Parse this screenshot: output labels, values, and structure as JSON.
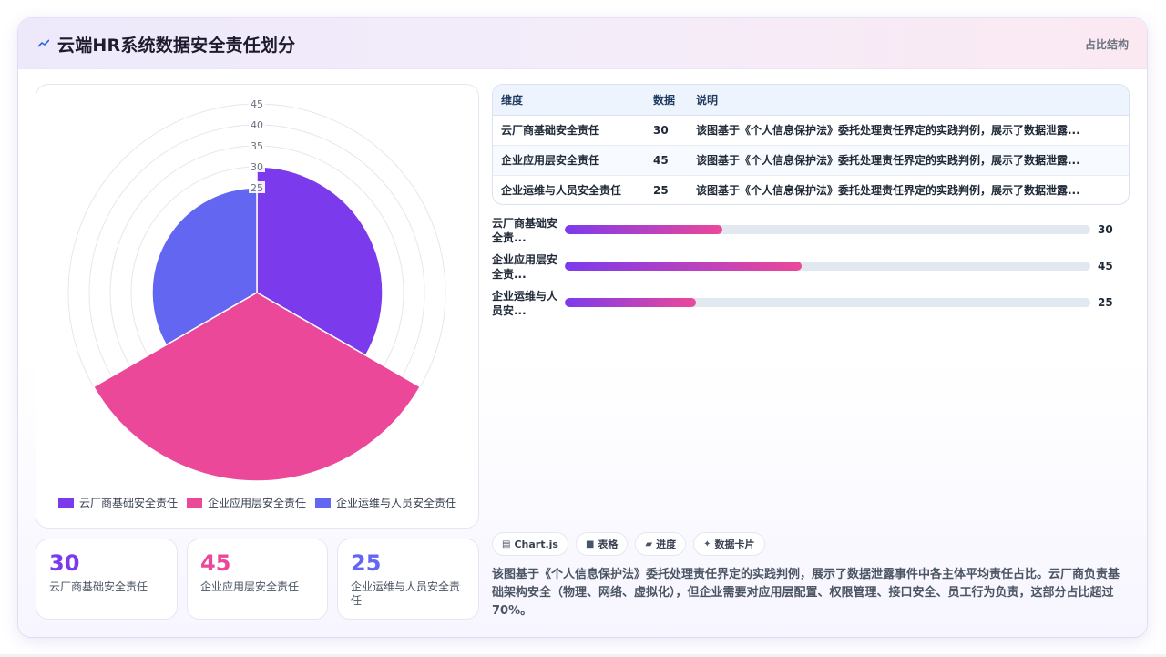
{
  "header": {
    "title": "云端HR系统数据安全责任划分",
    "tag": "占比结构",
    "icon": "trend-line-icon"
  },
  "colors": {
    "series": [
      "#7c3aed",
      "#ec4899",
      "#6366f1"
    ],
    "gradient_start": "#7c3aed",
    "gradient_end": "#ec4899"
  },
  "chart_data": {
    "type": "polar-area",
    "categories": [
      "云厂商基础安全责任",
      "企业应用层安全责任",
      "企业运维与人员安全责任"
    ],
    "values": [
      30,
      45,
      25
    ],
    "radial_ticks": [
      "25",
      "30",
      "35",
      "40",
      "45"
    ],
    "r_max": 45,
    "legend_position": "bottom",
    "grid": true
  },
  "stats": [
    {
      "value": "30",
      "label": "云厂商基础安全责任",
      "color": "#7c3aed"
    },
    {
      "value": "45",
      "label": "企业应用层安全责任",
      "color": "#ec4899"
    },
    {
      "value": "25",
      "label": "企业运维与人员安全责任",
      "color": "#6366f1"
    }
  ],
  "table": {
    "headers": [
      "维度",
      "数据",
      "说明"
    ],
    "rows": [
      {
        "dim": "云厂商基础安全责任",
        "val": "30",
        "desc": "该图基于《个人信息保护法》委托处理责任界定的实践判例，展示了数据泄露..."
      },
      {
        "dim": "企业应用层安全责任",
        "val": "45",
        "desc": "该图基于《个人信息保护法》委托处理责任界定的实践判例，展示了数据泄露..."
      },
      {
        "dim": "企业运维与人员安全责任",
        "val": "25",
        "desc": "该图基于《个人信息保护法》委托处理责任界定的实践判例，展示了数据泄露..."
      }
    ]
  },
  "progress": {
    "max": 100,
    "items": [
      {
        "label": "云厂商基础安全责...",
        "value": 30
      },
      {
        "label": "企业应用层安全责...",
        "value": 45
      },
      {
        "label": "企业运维与人员安...",
        "value": 25
      }
    ]
  },
  "chips": [
    {
      "icon": "chart-icon",
      "glyph": "▤",
      "label": "Chart.js"
    },
    {
      "icon": "table-icon",
      "glyph": "■",
      "label": "表格"
    },
    {
      "icon": "progress-icon",
      "glyph": "▰",
      "label": "进度"
    },
    {
      "icon": "sparkle-icon",
      "glyph": "✦",
      "label": "数据卡片"
    }
  ],
  "description": "该图基于《个人信息保护法》委托处理责任界定的实践判例，展示了数据泄露事件中各主体平均责任占比。云厂商负责基础架构安全（物理、网络、虚拟化），但企业需要对应用层配置、权限管理、接口安全、员工行为负责，这部分占比超过70%。"
}
